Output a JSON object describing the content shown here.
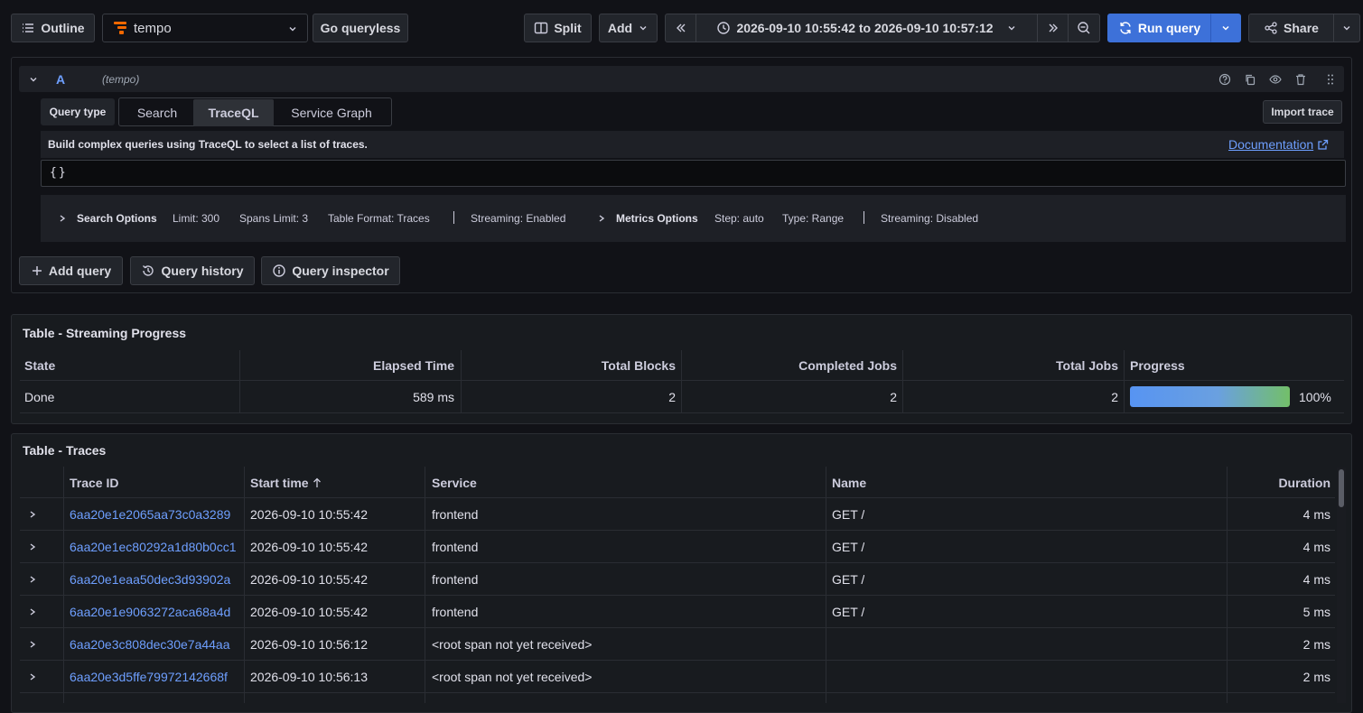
{
  "toolbar": {
    "outline_label": "Outline",
    "datasource_name": "tempo",
    "go_queryless_label": "Go queryless",
    "split_label": "Split",
    "add_label": "Add",
    "time_range": "2026-09-10 10:55:42 to 2026-09-10 10:57:12",
    "run_query_label": "Run query",
    "share_label": "Share"
  },
  "query": {
    "letter": "A",
    "datasource": "(tempo)",
    "query_type_label": "Query type",
    "tabs": [
      "Search",
      "TraceQL",
      "Service Graph"
    ],
    "active_tab": "TraceQL",
    "import_trace_label": "Import trace",
    "help_text": "Build complex queries using TraceQL to select a list of traces.",
    "documentation_label": "Documentation",
    "editor_value": "{}",
    "search_options": {
      "title": "Search Options",
      "limit": "Limit: 300",
      "spans_limit": "Spans Limit: 3",
      "table_format": "Table Format: Traces",
      "streaming": "Streaming: Enabled"
    },
    "metrics_options": {
      "title": "Metrics Options",
      "step": "Step: auto",
      "type": "Type: Range",
      "streaming": "Streaming: Disabled"
    }
  },
  "actions": {
    "add_query": "Add query",
    "query_history": "Query history",
    "query_inspector": "Query inspector"
  },
  "streaming": {
    "title": "Table - Streaming Progress",
    "columns": [
      "State",
      "Elapsed Time",
      "Total Blocks",
      "Completed Jobs",
      "Total Jobs",
      "Progress"
    ],
    "row": {
      "state": "Done",
      "elapsed": "589 ms",
      "total_blocks": "2",
      "completed_jobs": "2",
      "total_jobs": "2",
      "progress_label": "100%",
      "progress_value": 1.0
    }
  },
  "traces": {
    "title": "Table - Traces",
    "columns": [
      "Trace ID",
      "Start time",
      "Service",
      "Name",
      "Duration"
    ],
    "rows": [
      {
        "trace_id": "6aa20e1e2065aa73c0a3289",
        "start": "2026-09-10 10:55:42",
        "service": "frontend",
        "name": "GET /",
        "duration": "4 ms"
      },
      {
        "trace_id": "6aa20e1ec80292a1d80b0cc1",
        "start": "2026-09-10 10:55:42",
        "service": "frontend",
        "name": "GET /",
        "duration": "4 ms"
      },
      {
        "trace_id": "6aa20e1eaa50dec3d93902a",
        "start": "2026-09-10 10:55:42",
        "service": "frontend",
        "name": "GET /",
        "duration": "4 ms"
      },
      {
        "trace_id": "6aa20e1e9063272aca68a4d",
        "start": "2026-09-10 10:55:42",
        "service": "frontend",
        "name": "GET /",
        "duration": "5 ms"
      },
      {
        "trace_id": "6aa20e3c808dec30e7a44aa",
        "start": "2026-09-10 10:56:12",
        "service": "<root span not yet received>",
        "name": "",
        "duration": "2 ms"
      },
      {
        "trace_id": "6aa20e3d5ffe79972142668f",
        "start": "2026-09-10 10:56:13",
        "service": "<root span not yet received>",
        "name": "",
        "duration": "2 ms"
      }
    ]
  },
  "colors": {
    "run_query": "#3d71d9",
    "link": "#6e9fff",
    "progress_start": "#5794f2",
    "progress_end": "#73bf69",
    "logo": "#f46800"
  }
}
